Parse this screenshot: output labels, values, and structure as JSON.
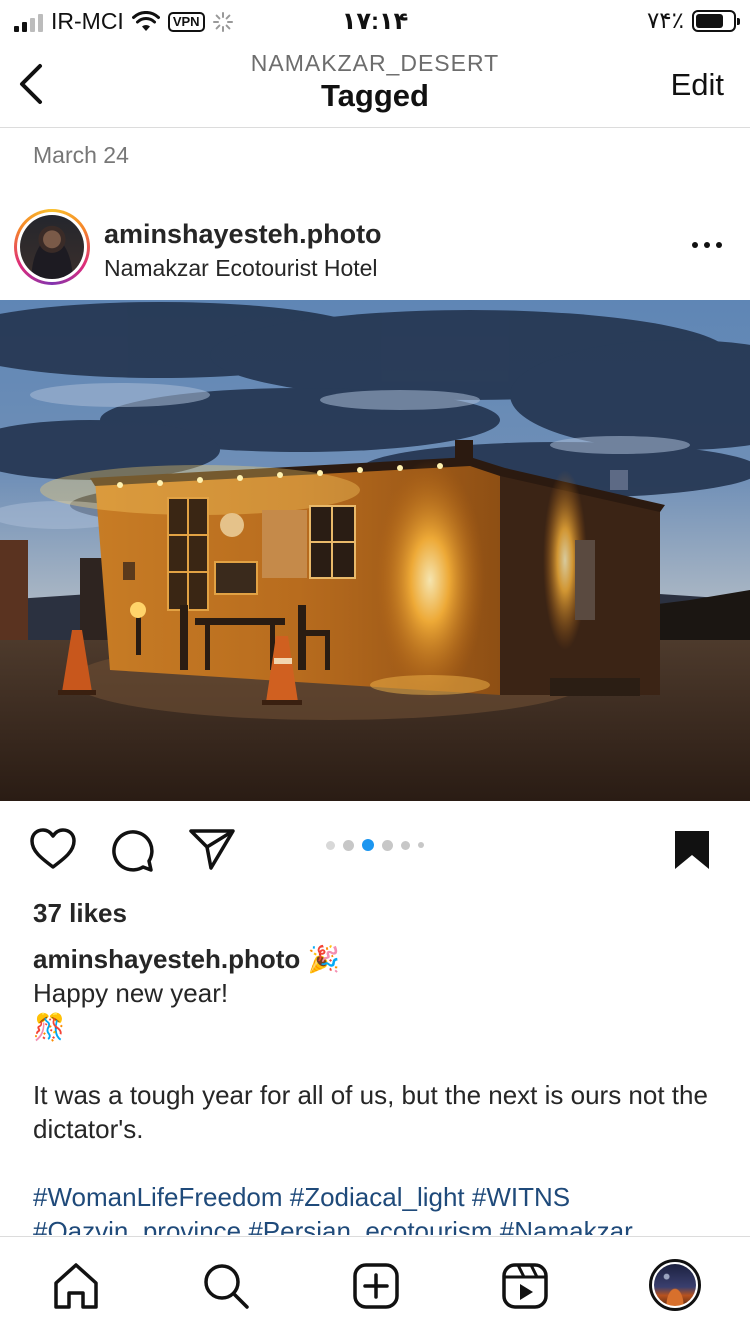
{
  "status_bar": {
    "carrier": "IR-MCI",
    "vpn": "VPN",
    "time": "۱۷:۱۴",
    "battery": "۷۴٪",
    "battery_level": 0.74
  },
  "header": {
    "subtitle": "NAMAKZAR_DESERT",
    "title": "Tagged",
    "edit_label": "Edit"
  },
  "date": "March 24",
  "post": {
    "username": "aminshayesteh.photo",
    "location": "Namakzar Ecotourist Hotel",
    "carousel": {
      "count": 6,
      "active": 2
    },
    "likes": "37 likes",
    "caption": {
      "username": "aminshayesteh.photo",
      "emoji_1": "🎉",
      "line_1": "Happy new year!",
      "emoji_2": "🎊",
      "body": "It was a tough year for all of us, but the next is ours not the dictator's.",
      "hashtags": "#WomanLifeFreedom #Zodiacal_light #WITNS",
      "hashtags_cut": "#Qazvin_province #Persian_ecotourism #Namakzar"
    }
  },
  "colors": {
    "accent_blue": "#1c96f0",
    "hashtag": "#1f4a7a",
    "text": "#262626",
    "muted": "#777777"
  },
  "nav": {
    "icons": [
      "home-icon",
      "search-icon",
      "new-post-icon",
      "reels-icon",
      "profile-avatar"
    ]
  }
}
